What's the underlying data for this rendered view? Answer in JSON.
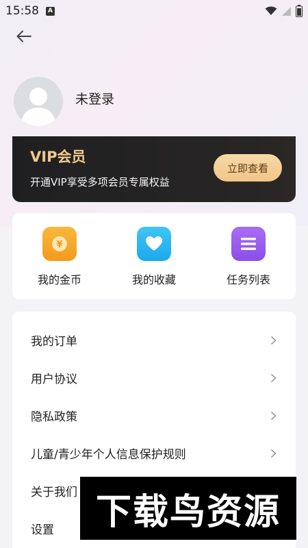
{
  "status_bar": {
    "time": "15:58",
    "notification_letter": "A"
  },
  "profile": {
    "login_status": "未登录"
  },
  "vip": {
    "title": "VIP会员",
    "subtitle": "开通VIP享受多项会员专属权益",
    "button_label": "立即查看",
    "accent_color": "#f0c98a"
  },
  "quick_actions": [
    {
      "label": "我的金币",
      "icon": "coin-icon",
      "color": "#f5a623"
    },
    {
      "label": "我的收藏",
      "icon": "heart-icon",
      "color": "#2eb8f0"
    },
    {
      "label": "任务列表",
      "icon": "list-icon",
      "color": "#9a5cf0"
    }
  ],
  "menu": [
    {
      "label": "我的订单"
    },
    {
      "label": "用户协议"
    },
    {
      "label": "隐私政策"
    },
    {
      "label": "儿童/青少年个人信息保护规则"
    },
    {
      "label": "关于我们"
    },
    {
      "label": "设置"
    }
  ],
  "watermark": {
    "text": "下载鸟资源"
  }
}
